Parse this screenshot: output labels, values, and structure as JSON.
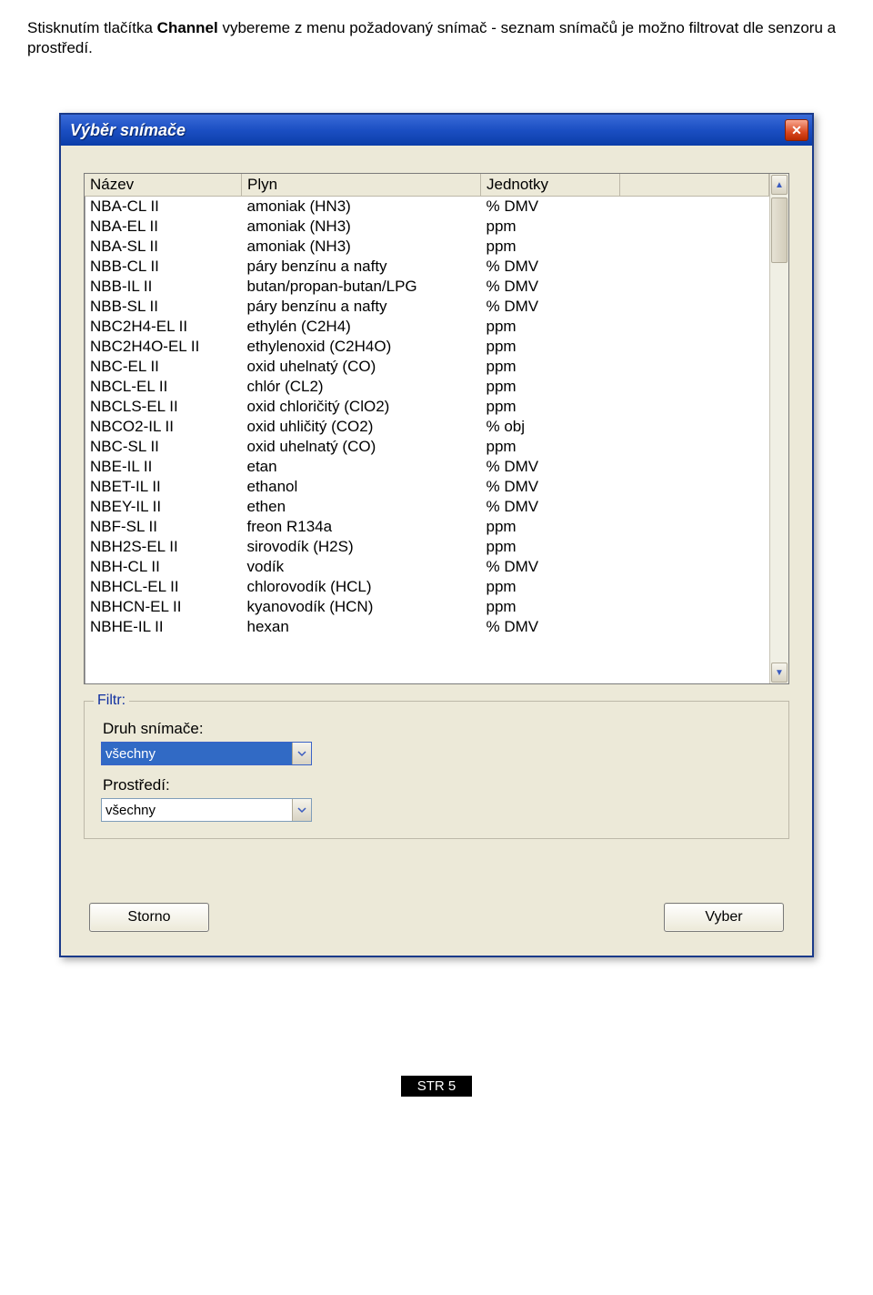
{
  "intro": {
    "prefix": "Stisknutím tlačítka ",
    "bold": "Channel",
    "suffix": " vybereme z menu požadovaný snímač - seznam snímačů je možno filtrovat dle senzoru a prostředí."
  },
  "dialog": {
    "title": "Výběr snímače",
    "close_icon": "x-icon"
  },
  "table": {
    "columns": {
      "name": "Název",
      "gas": "Plyn",
      "units": "Jednotky"
    },
    "rows": [
      {
        "name": "NBA-CL II",
        "gas": "amoniak (HN3)",
        "units": "% DMV"
      },
      {
        "name": "NBA-EL II",
        "gas": "amoniak (NH3)",
        "units": "ppm"
      },
      {
        "name": "NBA-SL II",
        "gas": "amoniak (NH3)",
        "units": "ppm"
      },
      {
        "name": "NBB-CL II",
        "gas": "páry benzínu a nafty",
        "units": "% DMV"
      },
      {
        "name": "NBB-IL II",
        "gas": "butan/propan-butan/LPG",
        "units": "% DMV"
      },
      {
        "name": "NBB-SL II",
        "gas": "páry benzínu a nafty",
        "units": "% DMV"
      },
      {
        "name": "NBC2H4-EL II",
        "gas": "ethylén (C2H4)",
        "units": "ppm"
      },
      {
        "name": "NBC2H4O-EL II",
        "gas": "ethylenoxid (C2H4O)",
        "units": "ppm"
      },
      {
        "name": "NBC-EL II",
        "gas": "oxid uhelnatý (CO)",
        "units": "ppm"
      },
      {
        "name": "NBCL-EL II",
        "gas": "chlór (CL2)",
        "units": "ppm"
      },
      {
        "name": "NBCLS-EL II",
        "gas": "oxid chloričitý (ClO2)",
        "units": "ppm"
      },
      {
        "name": "NBCO2-IL II",
        "gas": "oxid uhličitý (CO2)",
        "units": "% obj"
      },
      {
        "name": "NBC-SL II",
        "gas": "oxid uhelnatý (CO)",
        "units": "ppm"
      },
      {
        "name": "NBE-IL II",
        "gas": "etan",
        "units": "% DMV"
      },
      {
        "name": "NBET-IL II",
        "gas": "ethanol",
        "units": "% DMV"
      },
      {
        "name": "NBEY-IL II",
        "gas": "ethen",
        "units": "% DMV"
      },
      {
        "name": "NBF-SL II",
        "gas": "freon R134a",
        "units": "ppm"
      },
      {
        "name": "NBH2S-EL II",
        "gas": "sirovodík (H2S)",
        "units": "ppm"
      },
      {
        "name": "NBH-CL II",
        "gas": "vodík",
        "units": "% DMV"
      },
      {
        "name": "NBHCL-EL II",
        "gas": "chlorovodík (HCL)",
        "units": "ppm"
      },
      {
        "name": "NBHCN-EL II",
        "gas": "kyanovodík (HCN)",
        "units": "ppm"
      },
      {
        "name": "NBHE-IL II",
        "gas": "hexan",
        "units": "% DMV"
      }
    ]
  },
  "filter": {
    "legend": "Filtr:",
    "type_label": "Druh snímače:",
    "type_value": "všechny",
    "env_label": "Prostředí:",
    "env_value": "všechny"
  },
  "buttons": {
    "cancel": "Storno",
    "select": "Vyber"
  },
  "page_label": "STR 5"
}
